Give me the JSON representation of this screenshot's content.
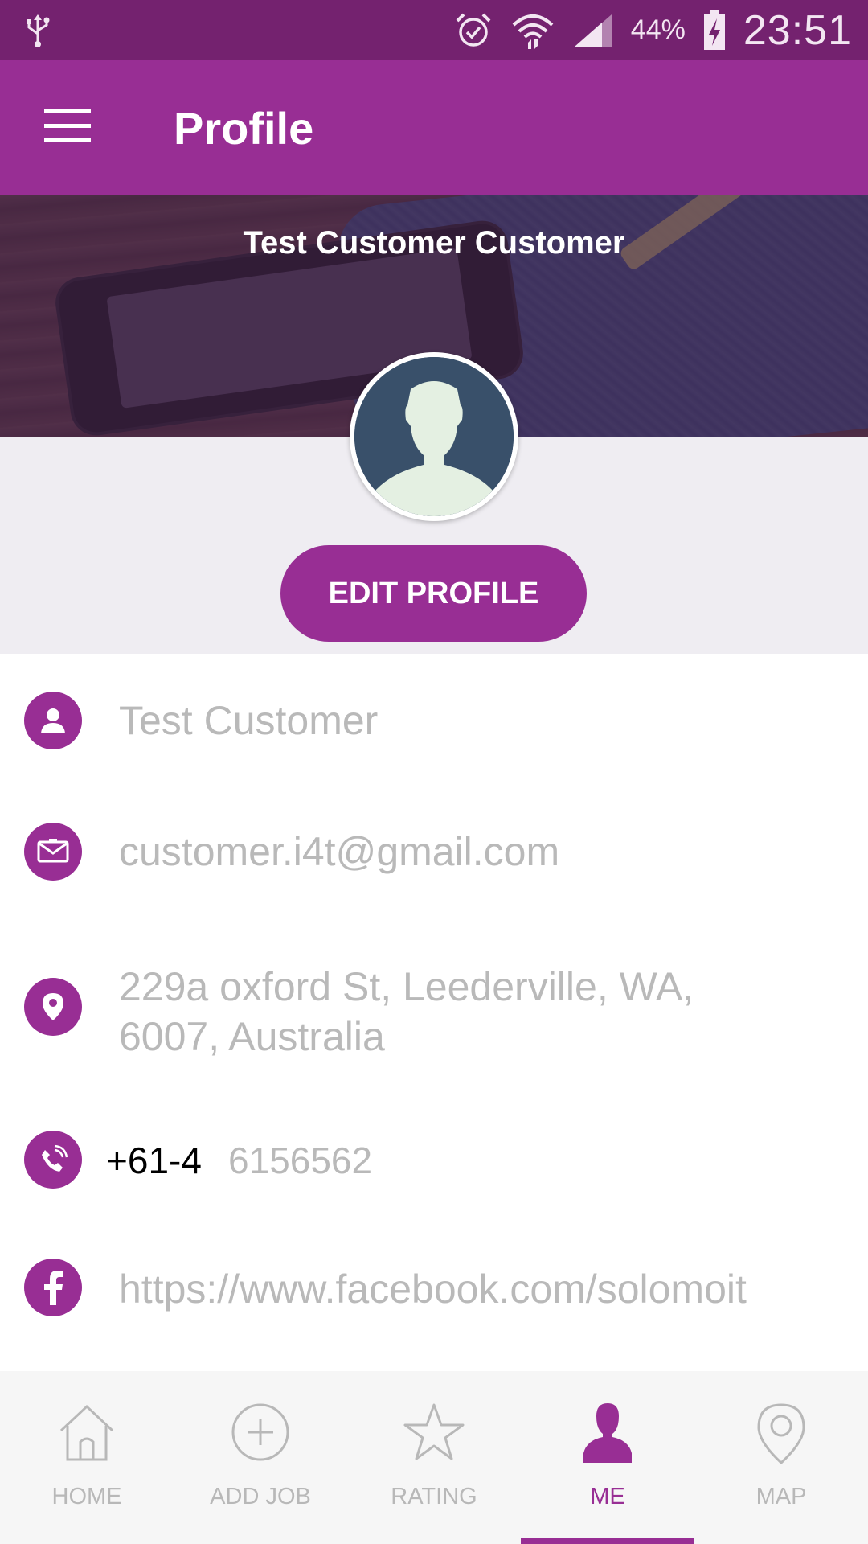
{
  "status_bar": {
    "battery_percent": "44%",
    "time": "23:51",
    "icons": [
      "usb-icon",
      "alarm-icon",
      "wifi-icon",
      "signal-icon",
      "battery-charging-icon"
    ]
  },
  "app_bar": {
    "title": "Profile",
    "menu_icon": "hamburger-menu-icon"
  },
  "header": {
    "display_name": "Test Customer  Customer",
    "avatar_icon": "default-avatar-icon"
  },
  "actions": {
    "edit_profile_label": "EDIT PROFILE"
  },
  "info": {
    "name": "Test Customer",
    "email": "customer.i4t@gmail.com",
    "address_line1": "229a oxford St, Leederville, WA,",
    "address_line2": "6007, Australia",
    "phone_prefix": "+61-4",
    "phone_number": "6156562",
    "facebook": "https://www.facebook.com/solomoit"
  },
  "bottom_nav": {
    "items": [
      {
        "label": "HOME",
        "icon": "home-icon"
      },
      {
        "label": "ADD JOB",
        "icon": "add-circle-icon"
      },
      {
        "label": "RATING",
        "icon": "star-icon"
      },
      {
        "label": "ME",
        "icon": "person-icon",
        "active": true
      },
      {
        "label": "MAP",
        "icon": "map-pin-icon"
      }
    ]
  },
  "colors": {
    "primary": "#982e94",
    "status_bar": "#74226f",
    "placeholder_text": "#b9b9b9",
    "grey_band": "#efedf2"
  }
}
